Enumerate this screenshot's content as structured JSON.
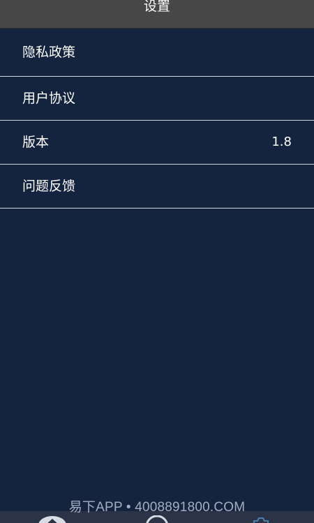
{
  "header": {
    "title": "设置"
  },
  "menu": {
    "items": [
      {
        "label": "隐私政策"
      },
      {
        "label": "用户协议"
      },
      {
        "label": "版本",
        "value": "1.8"
      },
      {
        "label": "问题反馈"
      }
    ]
  },
  "tabbar": {
    "tabs": [
      {
        "icon": "home-icon"
      },
      {
        "icon": "circle-icon"
      },
      {
        "icon": "settings-icon"
      }
    ]
  },
  "watermark": {
    "text": "易下APP • 4008891800.COM"
  },
  "colors": {
    "header_bg": "#474747",
    "page_bg": "#14243f",
    "divider": "#cfd6e0",
    "tabbar_bg": "#2b3346"
  }
}
